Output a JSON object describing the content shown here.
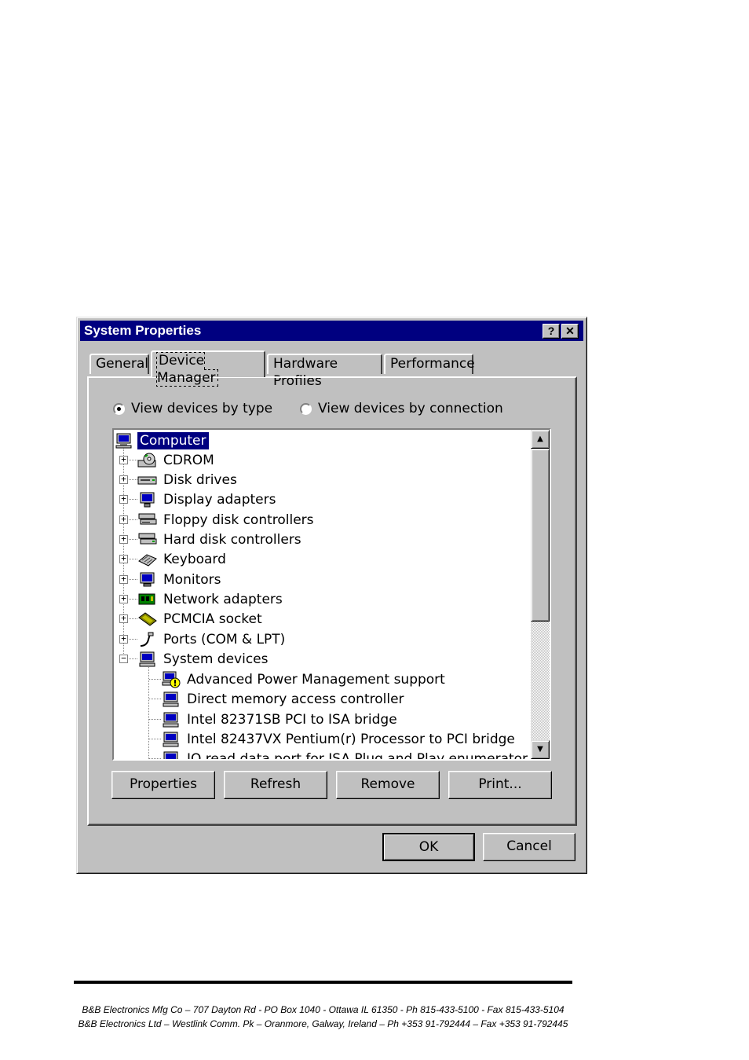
{
  "window": {
    "title": "System Properties",
    "help_label": "?",
    "close_label": "✕"
  },
  "tabs": [
    {
      "label": "General",
      "active": false
    },
    {
      "label": "Device Manager",
      "active": true
    },
    {
      "label": "Hardware Profiles",
      "active": false
    },
    {
      "label": "Performance",
      "active": false
    }
  ],
  "view_options": [
    {
      "label": "View devices by type",
      "selected": true
    },
    {
      "label": "View devices by connection",
      "selected": false
    }
  ],
  "tree": {
    "root": {
      "label": "Computer",
      "icon": "computer-icon"
    },
    "categories": [
      {
        "label": "CDROM",
        "icon": "cdrom-icon",
        "expander": "+"
      },
      {
        "label": "Disk drives",
        "icon": "disk-drive-icon",
        "expander": "+"
      },
      {
        "label": "Display adapters",
        "icon": "display-adapter-icon",
        "expander": "+"
      },
      {
        "label": "Floppy disk controllers",
        "icon": "floppy-controller-icon",
        "expander": "+"
      },
      {
        "label": "Hard disk controllers",
        "icon": "hard-disk-controller-icon",
        "expander": "+"
      },
      {
        "label": "Keyboard",
        "icon": "keyboard-icon",
        "expander": "+"
      },
      {
        "label": "Monitors",
        "icon": "monitor-icon",
        "expander": "+"
      },
      {
        "label": "Network adapters",
        "icon": "network-adapter-icon",
        "expander": "+"
      },
      {
        "label": "PCMCIA socket",
        "icon": "pcmcia-icon",
        "expander": "+"
      },
      {
        "label": "Ports (COM & LPT)",
        "icon": "port-icon",
        "expander": "+"
      },
      {
        "label": "System devices",
        "icon": "system-device-icon",
        "expander": "−"
      }
    ],
    "system_devices": [
      {
        "label": "Advanced Power Management support",
        "icon": "warning-device-icon"
      },
      {
        "label": "Direct memory access controller",
        "icon": "system-device-icon"
      },
      {
        "label": "Intel 82371SB PCI to ISA bridge",
        "icon": "system-device-icon"
      },
      {
        "label": "Intel 82437VX Pentium(r) Processor to PCI bridge",
        "icon": "system-device-icon"
      },
      {
        "label": "IO read data port for ISA Plug and Play enumerator",
        "icon": "system-device-icon"
      }
    ]
  },
  "scroll": {
    "up": "▲",
    "down": "▼"
  },
  "actions": [
    "Properties",
    "Refresh",
    "Remove",
    "Print..."
  ],
  "dialog_buttons": {
    "ok": "OK",
    "cancel": "Cancel"
  },
  "footer": {
    "line1": "B&B Electronics Mfg Co – 707 Dayton Rd - PO Box 1040 - Ottawa IL 61350 - Ph 815-433-5100 - Fax 815-433-5104",
    "line2": "B&B Electronics Ltd – Westlink Comm. Pk – Oranmore, Galway, Ireland – Ph +353 91-792444 – Fax +353 91-792445"
  }
}
